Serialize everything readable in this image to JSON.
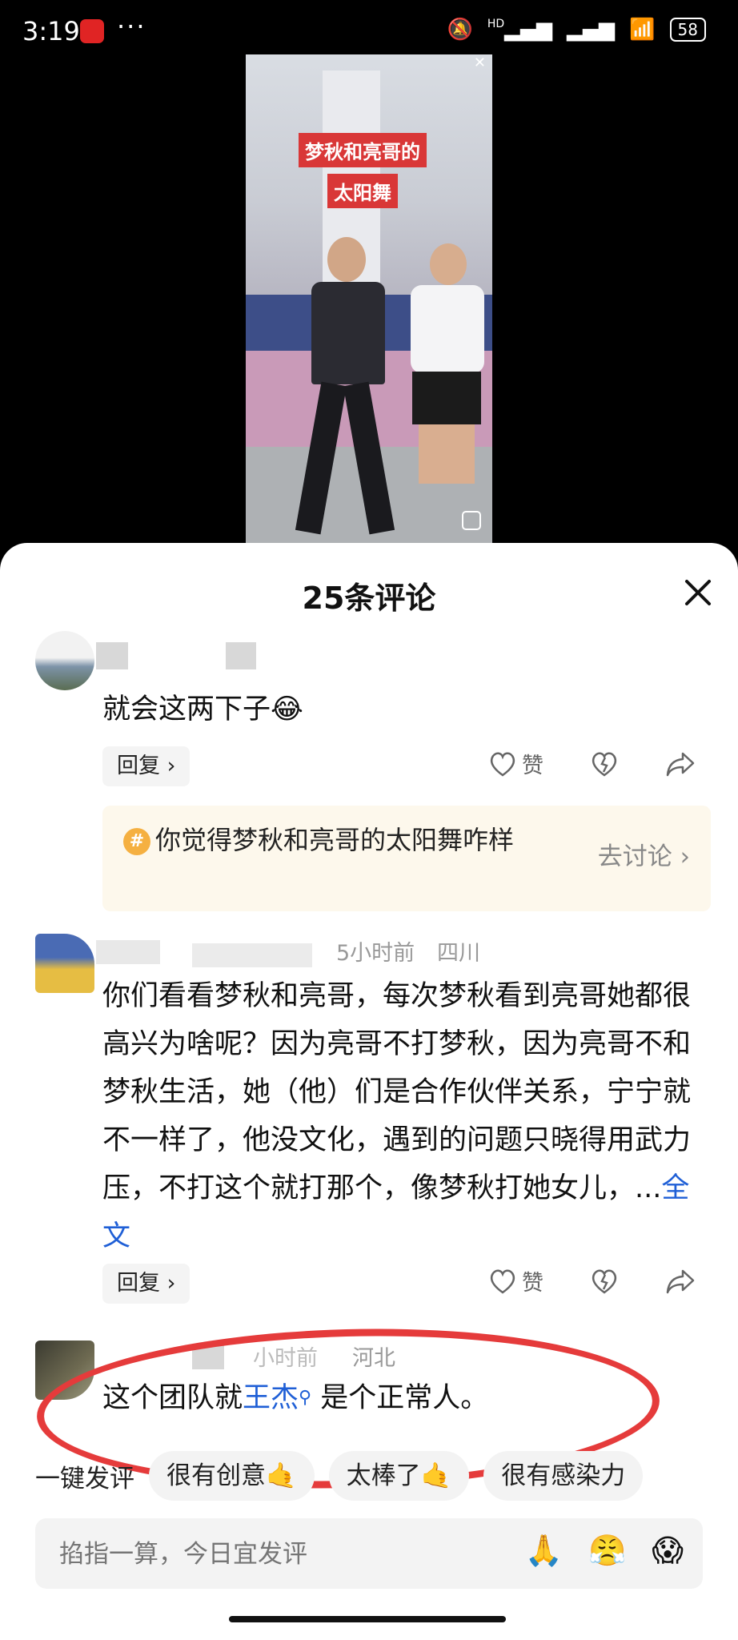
{
  "status_bar": {
    "time": "3:19",
    "more": "···",
    "network_label": "HD",
    "battery": "58"
  },
  "video": {
    "caption_line1": "梦秋和亮哥的",
    "caption_line2": "太阳舞"
  },
  "sheet": {
    "title": "25条评论",
    "close_icon": "close-icon"
  },
  "comments": [
    {
      "text": "就会这两下子😂",
      "reply_label": "回复 ›",
      "like_label": "赞"
    },
    {
      "meta_time": "5小时前",
      "meta_location": "四川",
      "text_main": "你们看看梦秋和亮哥，每次梦秋看到亮哥她都很高兴为啥呢？因为亮哥不打梦秋，因为亮哥不和梦秋生活，她（他）们是合作伙伴关系，宁宁就不一样了，他没文化，遇到的问题只晓得用武力压，不打这个就打那个，像梦秋打她女儿，...",
      "full_text_link": "全文",
      "reply_label": "回复 ›",
      "like_label": "赞"
    },
    {
      "meta_time": "小时前",
      "meta_location": "河北",
      "text_before": "这个团队就",
      "mention": "王杰",
      "text_after": " 是个正常人。"
    }
  ],
  "topic": {
    "hash": "#",
    "text": "你觉得梦秋和亮哥的太阳舞咋样",
    "link": "去讨论 ›"
  },
  "quick_comments": {
    "label": "一键发评",
    "chips": [
      "很有创意🤙",
      "太棒了🤙",
      "很有感染力"
    ]
  },
  "input": {
    "placeholder": "掐指一算，今日宜发评"
  },
  "emojis": [
    "🙏",
    "😤",
    "😱"
  ],
  "colors": {
    "highlight": "#e53b3b",
    "link": "#1f5fd6",
    "topic_bg": "#fdf8ec"
  }
}
